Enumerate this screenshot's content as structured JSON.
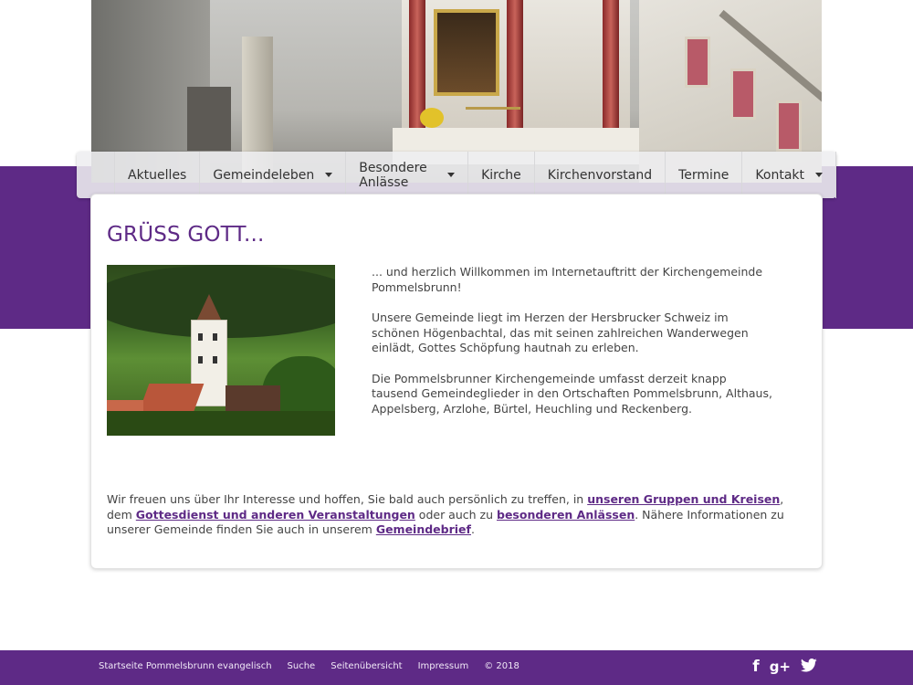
{
  "nav": {
    "items": [
      {
        "label": "Aktuelles",
        "has_dropdown": false
      },
      {
        "label": "Gemeindeleben",
        "has_dropdown": true
      },
      {
        "label": "Besondere Anlässe",
        "has_dropdown": true
      },
      {
        "label": "Kirche",
        "has_dropdown": false
      },
      {
        "label": "Kirchenvorstand",
        "has_dropdown": false
      },
      {
        "label": "Termine",
        "has_dropdown": false
      },
      {
        "label": "Kontakt",
        "has_dropdown": true
      }
    ]
  },
  "main": {
    "title": "GRÜSS GOTT...",
    "intro": [
      "... und herzlich Willkommen im Internetauftritt der Kirchengemeinde Pommelsbrunn!",
      "Unsere Gemeinde liegt im Herzen der Hersbrucker Schweiz im schönen Högenbachtal, das mit seinen zahlreichen Wanderwegen einlädt, Gottes Schöpfung hautnah zu erleben.",
      "Die Pommelsbrunner Kirchengemeinde umfasst derzeit knapp tausend Gemeindeglieder in den Ortschaften Pommelsbrunn, Althaus, Appelsberg, Arzlohe, Bürtel, Heuchling und Reckenberg."
    ],
    "outro": {
      "text_1": "Wir freuen uns über Ihr Interesse und hoffen, Sie bald auch persönlich zu treffen, in ",
      "link_1": "unseren Gruppen und Kreisen",
      "text_2": ", dem ",
      "link_2": "Gottesdienst und anderen Veranstaltungen",
      "text_3": " oder auch zu ",
      "link_3": "besonderen Anlässen",
      "text_4": ". Nähere Informationen zu unserer Gemeinde finden Sie auch in unserem ",
      "link_4": "Gemeindebrief",
      "text_5": "."
    }
  },
  "footer": {
    "links": [
      "Startseite Pommelsbrunn evangelisch",
      "Suche",
      "Seitenübersicht",
      "Impressum"
    ],
    "copyright": "© 2018",
    "social": {
      "facebook": "f",
      "googleplus": "g+"
    }
  },
  "colors": {
    "brand_purple": "#5e2a86",
    "footer_text": "#f1e9f7"
  }
}
